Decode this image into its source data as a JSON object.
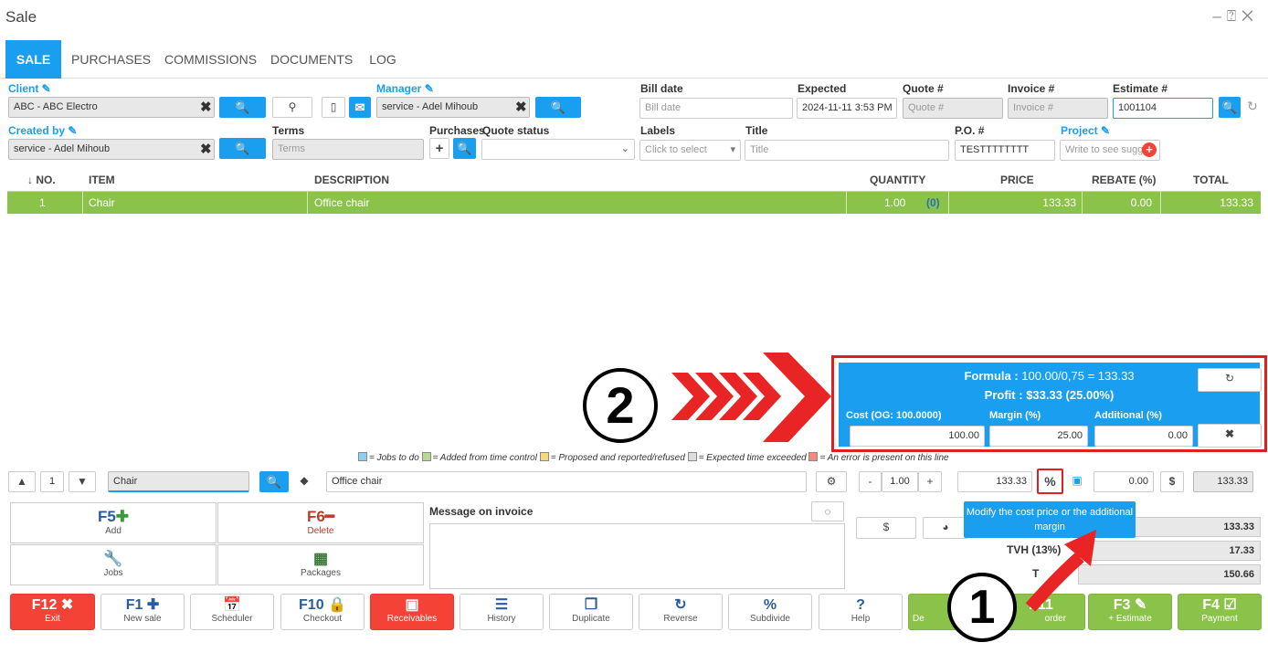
{
  "window": {
    "title": "Sale",
    "controls": "– ⍰ ✕"
  },
  "tabs": [
    "SALE",
    "PURCHASES",
    "COMMISSIONS",
    "DOCUMENTS",
    "LOG"
  ],
  "header": {
    "client_label": "Client",
    "client_value": "ABC - ABC Electro",
    "manager_label": "Manager",
    "manager_value": "service - Adel Mihoub",
    "bill_date_label": "Bill date",
    "bill_date_placeholder": "Bill date",
    "expected_label": "Expected",
    "expected_value": "2024-11-11 3:53 PM",
    "quote_label": "Quote #",
    "quote_placeholder": "Quote #",
    "invoice_label": "Invoice #",
    "invoice_placeholder": "Invoice #",
    "estimate_label": "Estimate #",
    "estimate_value": "1001104",
    "created_by_label": "Created by",
    "created_by_value": "service - Adel Mihoub",
    "terms_label": "Terms",
    "terms_placeholder": "Terms",
    "purchases_label": "Purchases",
    "quote_status_label": "Quote status",
    "labels_label": "Labels",
    "labels_placeholder": "Click to select",
    "title_label": "Title",
    "title_placeholder": "Title",
    "po_label": "P.O. #",
    "po_value": "TESTTTTTTTT",
    "project_label": "Project",
    "project_placeholder": "Write to see sugge"
  },
  "table": {
    "headers": [
      "↓ NO.",
      "ITEM",
      "DESCRIPTION",
      "QUANTITY",
      "PRICE",
      "REBATE (%)",
      "TOTAL"
    ],
    "rows": [
      {
        "no": "1",
        "item": "Chair",
        "description": "Office chair",
        "quantity": "1.00",
        "qty_extra": "(0)",
        "price": "133.33",
        "rebate": "0.00",
        "total": "133.33"
      }
    ]
  },
  "popup": {
    "formula_label": "Formula :",
    "formula_value": "100.00/0,75 = 133.33",
    "profit_label": "Profit :",
    "profit_value": "$33.33 (25.00%)",
    "cost_label": "Cost (OG: 100.0000)",
    "cost_value": "100.00",
    "margin_label": "Margin (%)",
    "margin_value": "25.00",
    "additional_label": "Additional (%)",
    "additional_value": "0.00"
  },
  "annotations": {
    "step1": "1",
    "step2": "2"
  },
  "legend": [
    "= Jobs to do",
    "= Added from time control",
    "= Proposed and reported/refused",
    "= Expected time exceeded",
    "= An error is present on this line"
  ],
  "legend_colors": [
    "#8ecdf5",
    "#b5dc8e",
    "#f5d97a",
    "#dddddd",
    "#f08a80"
  ],
  "line_editor": {
    "line_no": "1",
    "item": "Chair",
    "description": "Office chair",
    "qty": "1.00",
    "price": "133.33",
    "percent": "%",
    "discount": "0.00",
    "dollar": "$",
    "total": "133.33"
  },
  "tooltip": "Modify the cost price or the additional margin",
  "actions": [
    {
      "key": "F5",
      "label": "Add"
    },
    {
      "key": "F6",
      "label": "Delete"
    },
    {
      "key": "",
      "label": "Jobs"
    },
    {
      "key": "",
      "label": "Packages"
    }
  ],
  "message": {
    "label": "Message on invoice"
  },
  "totals": {
    "subtotal": "133.33",
    "tax_label": "TVH (13%)",
    "tax": "17.33",
    "total_label": "T",
    "total": "150.66",
    "dollar": "$"
  },
  "bottom": [
    {
      "key": "F12",
      "label": "Exit"
    },
    {
      "key": "F1",
      "label": "New sale"
    },
    {
      "key": "",
      "label": "Scheduler"
    },
    {
      "key": "F10",
      "label": "Checkout"
    },
    {
      "key": "",
      "label": "Receivables"
    },
    {
      "key": "",
      "label": "History"
    },
    {
      "key": "",
      "label": "Duplicate"
    },
    {
      "key": "",
      "label": "Reverse"
    },
    {
      "key": "%",
      "label": "Subdivide"
    },
    {
      "key": "?",
      "label": "Help"
    },
    {
      "key": "",
      "label": "De"
    },
    {
      "key": "F11",
      "label": "order"
    },
    {
      "key": "F3",
      "label": "+ Estimate"
    },
    {
      "key": "F4",
      "label": "Payment"
    }
  ]
}
